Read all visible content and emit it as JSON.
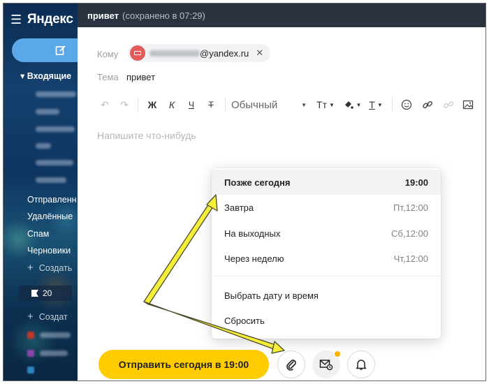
{
  "sidebar": {
    "logo": "Яндекс",
    "compose_icon": "edit-icon",
    "folders": {
      "inbox": "Входящие",
      "sent": "Отправленн",
      "deleted": "Удалённые",
      "spam": "Спам",
      "drafts": "Черновики"
    },
    "create_folder": "Создать",
    "create_label": "Создат",
    "flagged_count": "20"
  },
  "compose": {
    "title": "привет",
    "saved_status": "(сохранено в 07:29)",
    "to_label": "Кому",
    "recipient_domain": "@yandex.ru",
    "subject_label": "Тема",
    "subject_value": "привет",
    "toolbar": {
      "bold": "Ж",
      "italic": "К",
      "underline": "Ч",
      "strike": "Т",
      "style": "Обычный",
      "font_size": "Тт",
      "text_color": "Т"
    },
    "body_placeholder": "Напишите что-нибудь"
  },
  "schedule_menu": {
    "items": [
      {
        "label": "Позже сегодня",
        "time": "19:00"
      },
      {
        "label": "Завтра",
        "time": "Пт,12:00"
      },
      {
        "label": "На выходных",
        "time": "Сб,12:00"
      },
      {
        "label": "Через неделю",
        "time": "Чт,12:00"
      }
    ],
    "pick_datetime": "Выбрать дату и время",
    "reset": "Сбросить"
  },
  "bottom": {
    "send_label": "Отправить сегодня в 19:00",
    "attach_icon": "paperclip-icon",
    "schedule_icon": "envelope-clock-icon",
    "reminder_icon": "bell-icon"
  },
  "colors": {
    "send_button": "#ffcc00",
    "titlebar": "#2c3340",
    "annotation_arrow": "#f5ef3a",
    "notification_dot": "#ffb300"
  }
}
